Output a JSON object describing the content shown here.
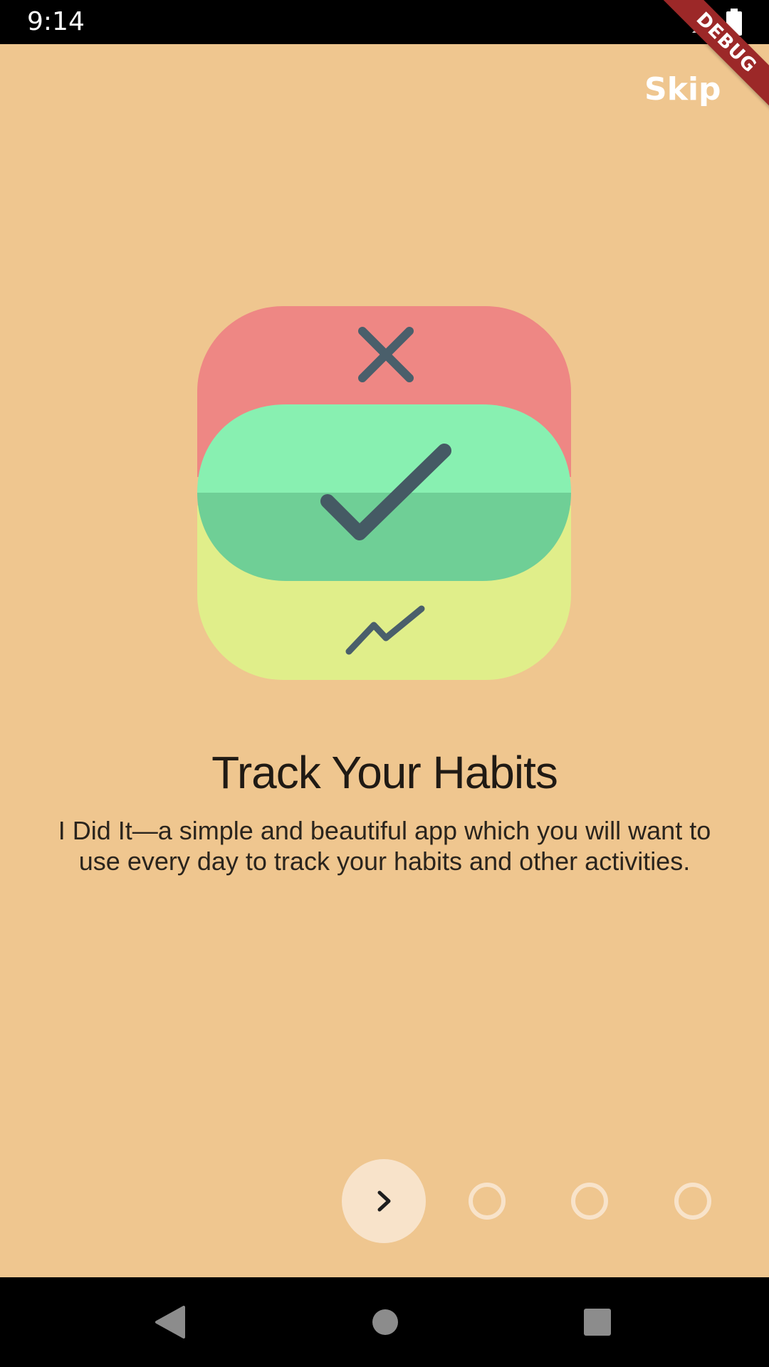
{
  "status_bar": {
    "time": "9:14",
    "icons": [
      "signal-icon",
      "battery-icon"
    ]
  },
  "debug_banner": "DEBUG",
  "header": {
    "skip_label": "Skip"
  },
  "onboarding": {
    "title": "Track Your Habits",
    "description": "I Did It—a simple and beautiful app which you will want to use every day to track your habits and other activities.",
    "illustration_icons": [
      "close-icon",
      "checkmark-icon",
      "trend-icon"
    ]
  },
  "pager": {
    "current_page": 1,
    "total_pages": 4,
    "next_icon": "chevron-right-icon"
  },
  "nav_bar": {
    "icons": [
      "back-icon",
      "home-icon",
      "recents-icon"
    ]
  },
  "colors": {
    "background": "#efc68f",
    "card_red": "#ee8784",
    "card_green": "#88f0b1",
    "card_yellow": "#e0ee8a",
    "icon_slate": "#455a64",
    "indicator": "#f8e3ca"
  }
}
